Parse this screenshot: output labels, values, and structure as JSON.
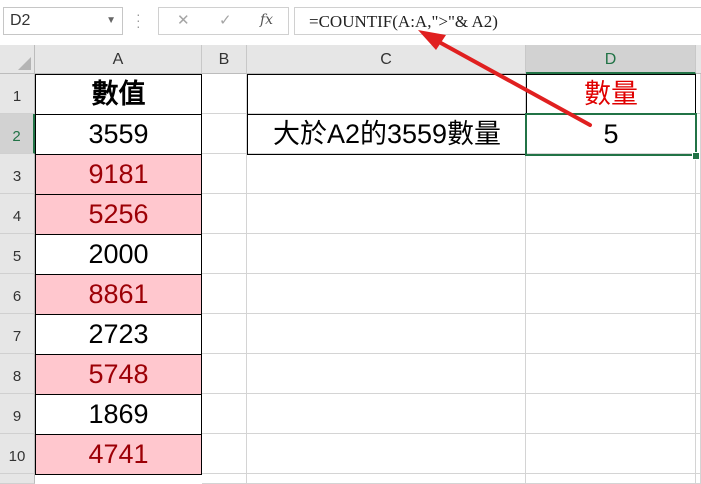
{
  "formula_bar": {
    "name_box": "D2",
    "cancel_icon": "✕",
    "enter_icon": "✓",
    "fx_label": "fx",
    "formula": "=COUNTIF(A:A,\">\"& A2)"
  },
  "columns": [
    "A",
    "B",
    "C",
    "D"
  ],
  "rows": [
    "1",
    "2",
    "3",
    "4",
    "5",
    "6",
    "7",
    "8",
    "9",
    "10"
  ],
  "cells": {
    "A1": "數值",
    "A2": "3559",
    "A3": "9181",
    "A4": "5256",
    "A5": "2000",
    "A6": "8861",
    "A7": "2723",
    "A8": "5748",
    "A9": "1869",
    "A10": "4741",
    "C2": "大於A2的3559數量",
    "D1": "數量",
    "D2": "5"
  },
  "colors": {
    "highlight_fill": "#ffc7ce",
    "highlight_text": "#9c0006",
    "header_red": "#e00000",
    "selection_green": "#217346",
    "arrow_red": "#e02020"
  }
}
